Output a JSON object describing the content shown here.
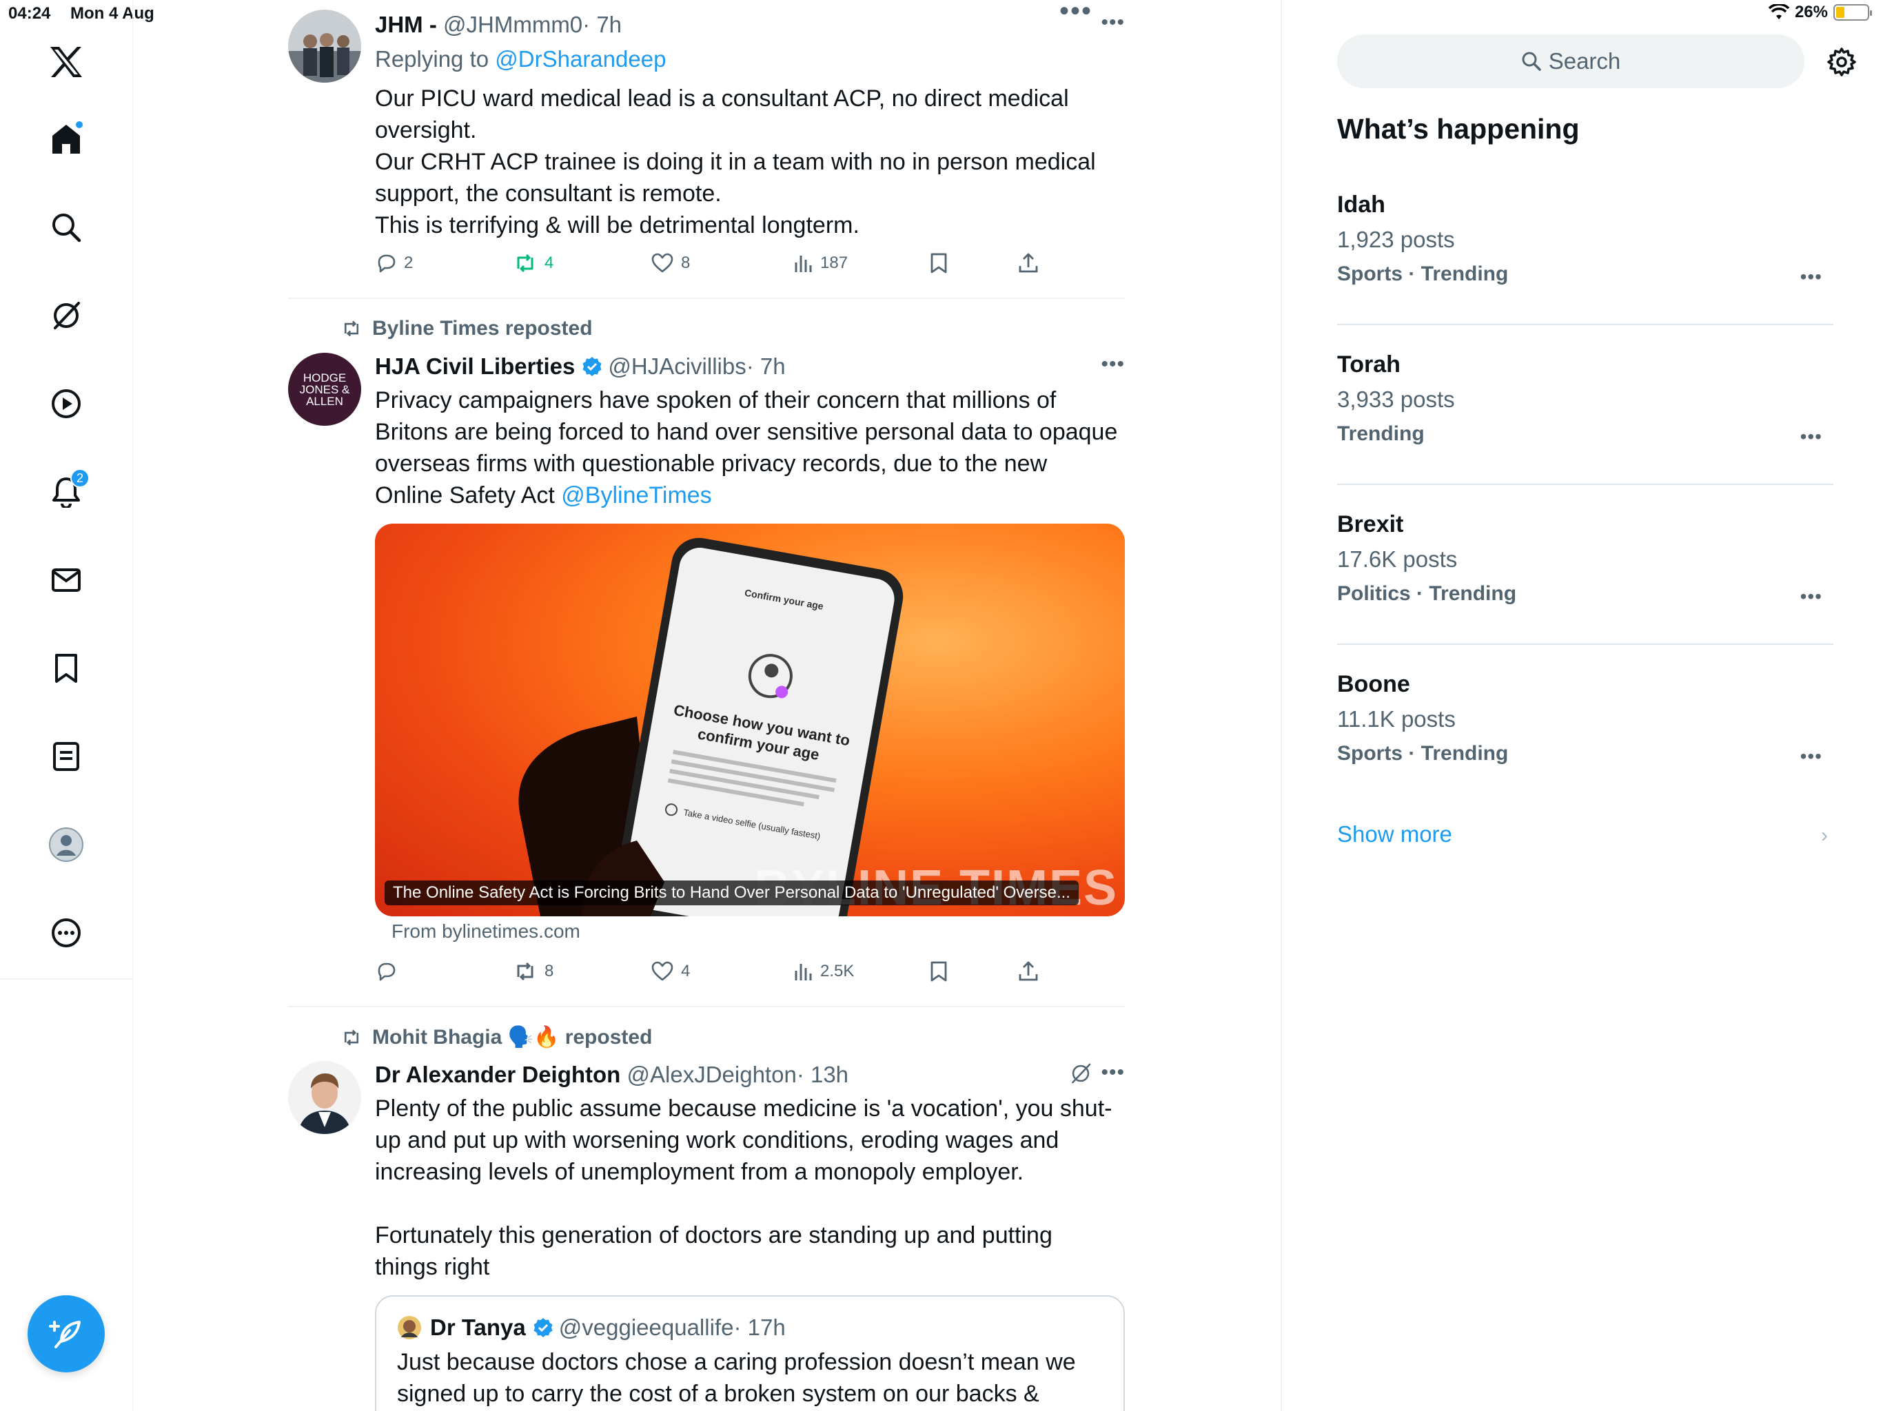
{
  "status_bar": {
    "time": "04:24",
    "date": "Mon 4 Aug",
    "battery": "26%",
    "battery_level": 0.26
  },
  "nav": {
    "notifications_badge": "2"
  },
  "tweets": [
    {
      "name": "JHM -",
      "handle": "@JHMmmm0",
      "time": "· 7h",
      "replying_prefix": "Replying to",
      "replying_to": "@DrSharandeep",
      "text_lines": [
        "Our PICU ward medical lead is a consultant ACP, no direct medical",
        "oversight.",
        "Our CRHT ACP trainee is doing it in a team with no in person medical",
        "support, the consultant is remote.",
        "This is terrifying & will be detrimental longterm."
      ],
      "replies": "2",
      "reposts": "4",
      "likes": "8",
      "views": "187"
    },
    {
      "reposted_by": "Byline Times reposted",
      "name": "HJA Civil Liberties",
      "handle": "@HJAcivillibs",
      "time": "· 7h",
      "avatar_text": [
        "HODGE",
        "JONES &",
        "ALLEN"
      ],
      "text_lines": [
        "Privacy campaigners have spoken of their concern that millions of",
        "Britons are being forced to hand over sensitive personal data to opaque",
        "overseas firms with questionable privacy records, due to the new"
      ],
      "text_last": "Online Safety Act ",
      "mention": "@BylineTimes",
      "card": {
        "phone_header": "Confirm your age",
        "phone_title_1": "Choose how you want to",
        "phone_title_2": "confirm your age",
        "phone_option": "Take a video selfie (usually fastest)",
        "caption": "The Online Safety Act is Forcing Brits to Hand Over Personal Data to 'Unregulated' Overse...",
        "watermark": "BYLINE TIMES",
        "from": "From bylinetimes.com"
      },
      "replies": "",
      "reposts": "8",
      "likes": "4",
      "views": "2.5K"
    },
    {
      "reposted_by": "Mohit Bhagia 🗣️🔥 reposted",
      "name": "Dr Alexander Deighton",
      "handle": "@AlexJDeighton",
      "time": "· 13h",
      "text_lines": [
        "Plenty of the public assume because medicine is 'a vocation', you shut-",
        "up and put up with worsening work conditions, eroding wages and",
        "increasing levels of unemployment from a monopoly employer.",
        "",
        "Fortunately this generation of doctors are standing up and putting",
        "things right"
      ],
      "quote": {
        "name": "Dr Tanya",
        "handle": "@veggieequallife",
        "time": "· 17h",
        "text_lines": [
          "Just because doctors chose a caring profession doesn’t mean we",
          "signed up to carry the cost of a broken system on our backs &"
        ]
      }
    }
  ],
  "sidebar": {
    "search_placeholder": "Search",
    "title": "What’s happening",
    "trends": [
      {
        "name": "Idah",
        "posts": "1,923 posts",
        "category": "Sports · Trending"
      },
      {
        "name": "Torah",
        "posts": "3,933 posts",
        "category": "Trending"
      },
      {
        "name": "Brexit",
        "posts": "17.6K posts",
        "category": "Politics · Trending"
      },
      {
        "name": "Boone",
        "posts": "11.1K posts",
        "category": "Sports · Trending"
      }
    ],
    "show_more": "Show more"
  },
  "colors": {
    "accent": "#1d9bf0",
    "repost_active": "#00ba7c",
    "muted": "#536471"
  }
}
